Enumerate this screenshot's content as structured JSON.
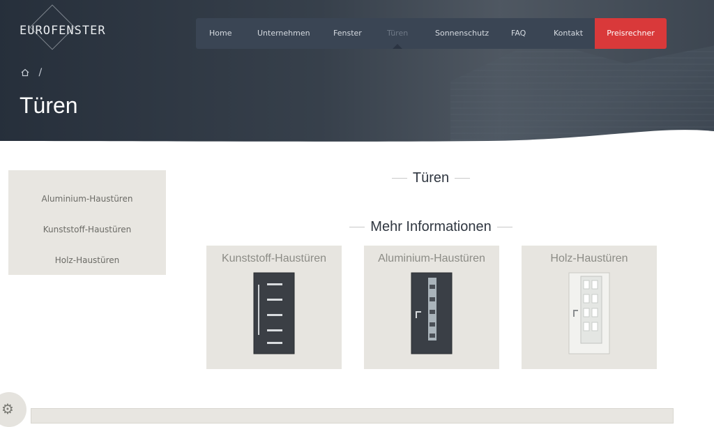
{
  "header": {
    "logo_text": "EUROFENSTER",
    "nav": [
      {
        "label": "Home",
        "active": false
      },
      {
        "label": "Unternehmen",
        "active": false
      },
      {
        "label": "Fenster",
        "active": false
      },
      {
        "label": "Türen",
        "active": true
      },
      {
        "label": "Sonnenschutz",
        "active": false
      },
      {
        "label": "FAQ",
        "active": false
      },
      {
        "label": "Kontakt",
        "active": false
      }
    ],
    "cta_label": "Preisrechner",
    "cta_color": "#d9393a"
  },
  "breadcrumb": {
    "home_icon": "home-icon",
    "separator": "/"
  },
  "page_title": "Türen",
  "sidebar": {
    "items": [
      {
        "label": "Aluminium-Haustüren"
      },
      {
        "label": "Kunststoff-Haustüren"
      },
      {
        "label": "Holz-Haustüren"
      }
    ]
  },
  "main": {
    "section_title": "Türen",
    "more_info_title": "Mehr Informationen",
    "cards": [
      {
        "title": "Kunststoff-Haustüren",
        "door": "dark-door-image"
      },
      {
        "title": "Aluminium-Haustüren",
        "door": "dark-door-glass-image"
      },
      {
        "title": "Holz-Haustüren",
        "door": "white-door-image"
      }
    ]
  },
  "settings_icon": "gear-icon"
}
